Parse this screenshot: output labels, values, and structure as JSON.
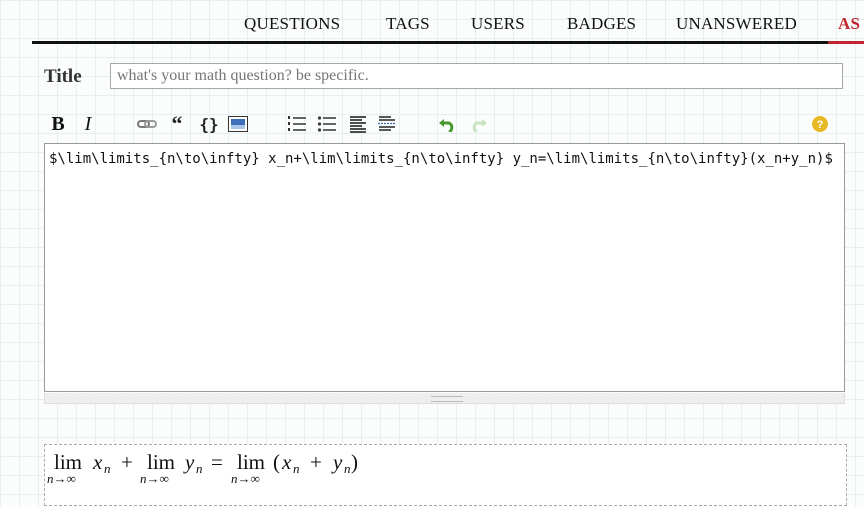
{
  "nav": {
    "items": [
      "QUESTIONS",
      "TAGS",
      "USERS",
      "BADGES",
      "UNANSWERED",
      "AS"
    ],
    "active_index": 5,
    "active_color": "#c0262d"
  },
  "form": {
    "title_label": "Title",
    "title_placeholder": "what's your math question? be specific.",
    "title_value": ""
  },
  "toolbar": {
    "buttons": [
      {
        "name": "bold",
        "label": "B",
        "icon": "bold-icon"
      },
      {
        "name": "italic",
        "label": "I",
        "icon": "italic-icon"
      },
      {
        "name": "link",
        "icon": "link-icon"
      },
      {
        "name": "blockquote",
        "label": "“",
        "icon": "quote-icon"
      },
      {
        "name": "code",
        "label": "{}",
        "icon": "code-icon"
      },
      {
        "name": "image",
        "icon": "image-icon"
      },
      {
        "name": "numbered-list",
        "icon": "numbered-list-icon"
      },
      {
        "name": "bulleted-list",
        "icon": "bulleted-list-icon"
      },
      {
        "name": "heading",
        "icon": "heading-icon"
      },
      {
        "name": "horizontal-rule",
        "icon": "horizontal-rule-icon"
      },
      {
        "name": "undo",
        "icon": "undo-icon",
        "color": "#4a9a2e"
      },
      {
        "name": "redo",
        "icon": "redo-icon",
        "disabled": true
      },
      {
        "name": "help",
        "label": "?",
        "icon": "help-icon",
        "color": "#e8b923"
      }
    ]
  },
  "editor": {
    "content": "$\\lim\\limits_{n\\to\\infty} x_n+\\lim\\limits_{n\\to\\infty} y_n=\\lim\\limits_{n\\to\\infty}(x_n+y_n)$"
  },
  "preview": {
    "lim": "lim",
    "sub": "n→∞",
    "x": "x",
    "y": "y",
    "n": "n",
    "plus": "+",
    "eq": "=",
    "lparen": "(",
    "rparen": ")"
  }
}
